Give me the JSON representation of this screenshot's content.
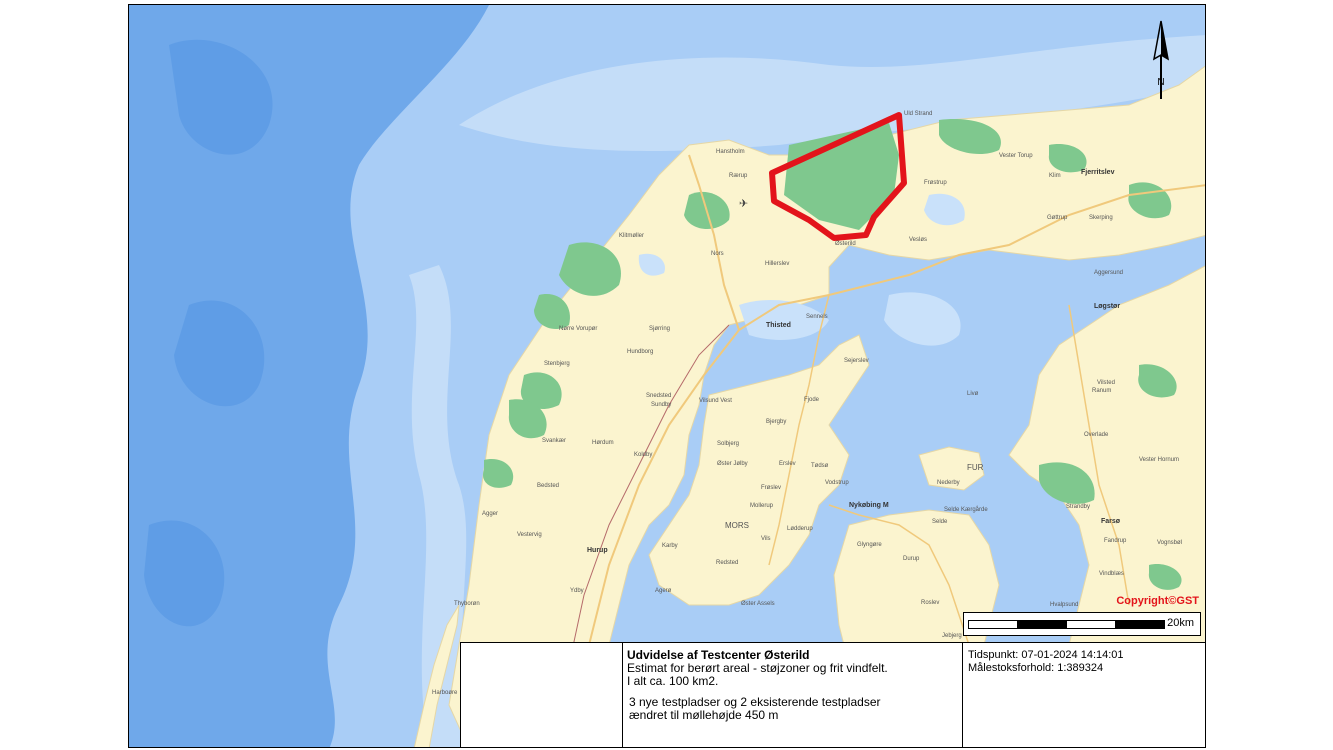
{
  "map": {
    "copyright": "Copyright©GST",
    "scale_label": "20km",
    "north_label": "N",
    "colors": {
      "sea": "#a9cdf6",
      "deep_sea": "#6fa8ea",
      "land": "#fbf4cf",
      "forest": "#7fc88e",
      "road": "#f0c97c",
      "boundary": "#e3141b"
    },
    "places": [
      {
        "name": "Hanstholm"
      },
      {
        "name": "Rærup"
      },
      {
        "name": "Uld Strand"
      },
      {
        "name": "Vester Torup"
      },
      {
        "name": "Klim"
      },
      {
        "name": "Fjerritslev"
      },
      {
        "name": "Frøstrup"
      },
      {
        "name": "Gøttrup"
      },
      {
        "name": "Skerping"
      },
      {
        "name": "Klitmøller"
      },
      {
        "name": "Nors"
      },
      {
        "name": "Hillerslev"
      },
      {
        "name": "Vesløs"
      },
      {
        "name": "Østerild"
      },
      {
        "name": "Aggersund"
      },
      {
        "name": "Løgstør"
      },
      {
        "name": "Nørre Vorupør"
      },
      {
        "name": "Sjørring"
      },
      {
        "name": "Thisted"
      },
      {
        "name": "Sennels"
      },
      {
        "name": "Hundborg"
      },
      {
        "name": "Sejerslev"
      },
      {
        "name": "Ranum"
      },
      {
        "name": "Vilsted"
      },
      {
        "name": "Stenbjerg"
      },
      {
        "name": "Snedsted"
      },
      {
        "name": "Sundby"
      },
      {
        "name": "Vilsund Vest"
      },
      {
        "name": "Fjode"
      },
      {
        "name": "Livø"
      },
      {
        "name": "Svankær"
      },
      {
        "name": "Hørdum"
      },
      {
        "name": "Bjergby"
      },
      {
        "name": "Koldby"
      },
      {
        "name": "Solbjerg"
      },
      {
        "name": "Øster Jølby"
      },
      {
        "name": "Erslev"
      },
      {
        "name": "Tødsø"
      },
      {
        "name": "FUR"
      },
      {
        "name": "Overlade"
      },
      {
        "name": "Vester Hornum"
      },
      {
        "name": "Bedsted"
      },
      {
        "name": "Frøslev"
      },
      {
        "name": "Vodstrup"
      },
      {
        "name": "Nederby"
      },
      {
        "name": "Selde Kærgårde"
      },
      {
        "name": "Selde"
      },
      {
        "name": "Strandby"
      },
      {
        "name": "Agger"
      },
      {
        "name": "Nykøbing M"
      },
      {
        "name": "Mollerup"
      },
      {
        "name": "MORS"
      },
      {
        "name": "Lødderup"
      },
      {
        "name": "Farsø"
      },
      {
        "name": "Vestervig"
      },
      {
        "name": "Hurup"
      },
      {
        "name": "Karby"
      },
      {
        "name": "Vils"
      },
      {
        "name": "Glyngøre"
      },
      {
        "name": "Durup"
      },
      {
        "name": "Fandrup"
      },
      {
        "name": "Vognsbøl"
      },
      {
        "name": "Redsted"
      },
      {
        "name": "Thyborøn"
      },
      {
        "name": "Ydby"
      },
      {
        "name": "Agerø"
      },
      {
        "name": "Øster Assels"
      },
      {
        "name": "Roslev"
      },
      {
        "name": "Harboøre"
      },
      {
        "name": "Vindblæs"
      },
      {
        "name": "Hvalpsund"
      },
      {
        "name": "Jebjerg"
      }
    ]
  },
  "info": {
    "title": "Udvidelse af Testcenter Østerild",
    "lines": [
      "Estimat for berørt areal - støjzoner og frit vindfelt.",
      "I alt ca. 100 km2."
    ],
    "note_lines": [
      "3 nye testpladser og 2 eksisterende testpladser",
      "ændret til møllehøjde 450 m"
    ],
    "timestamp": "Tidspunkt: 07-01-2024 14:14:01",
    "scale_ratio": "Målestoksforhold: 1:389324"
  }
}
